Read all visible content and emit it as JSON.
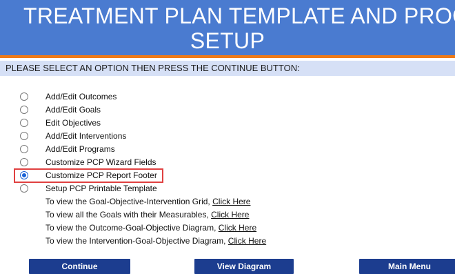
{
  "header": {
    "title_line1": "TREATMENT PLAN TEMPLATE AND PROGRAM",
    "title_line2": "SETUP"
  },
  "prompt": "PLEASE SELECT AN OPTION THEN PRESS THE CONTINUE BUTTON:",
  "options": [
    {
      "label": "Add/Edit Outcomes",
      "selected": false
    },
    {
      "label": "Add/Edit Goals",
      "selected": false
    },
    {
      "label": "Edit Objectives",
      "selected": false
    },
    {
      "label": "Add/Edit Interventions",
      "selected": false
    },
    {
      "label": "Add/Edit Programs",
      "selected": false
    },
    {
      "label": "Customize PCP Wizard Fields",
      "selected": false
    },
    {
      "label": "Customize PCP Report Footer",
      "selected": true
    },
    {
      "label": "Setup PCP Printable Template",
      "selected": false
    }
  ],
  "links": [
    {
      "text": "To view the Goal-Objective-Intervention Grid,",
      "link": "Click Here"
    },
    {
      "text": "To view all the Goals with their Measurables,",
      "link": "Click Here"
    },
    {
      "text": "To view the Outcome-Goal-Objective Diagram,",
      "link": "Click Here"
    },
    {
      "text": "To view the Intervention-Goal-Objective Diagram,",
      "link": "Click Here"
    }
  ],
  "buttons": {
    "continue": "Continue",
    "view_diagram": "View Diagram",
    "main_menu": "Main Menu"
  },
  "colors": {
    "header_bg": "#4a7bd0",
    "header_border": "#f07a16",
    "prompt_bg": "#d6e0f6",
    "button_bg": "#1c3d8f",
    "highlight_border": "#e04040",
    "radio_selected": "#1a62d6"
  }
}
